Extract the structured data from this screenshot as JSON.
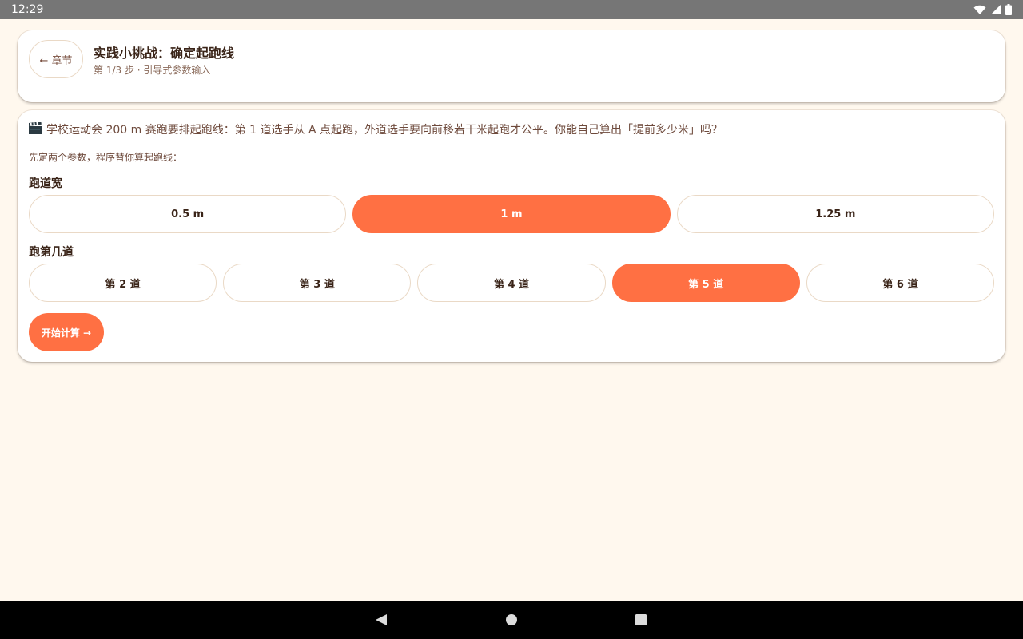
{
  "status_bar": {
    "time": "12:29",
    "icons": [
      "wifi-icon",
      "cell-signal-icon",
      "battery-icon"
    ]
  },
  "header": {
    "back_label": "← 章节",
    "title": "实践小挑战：确定起跑线",
    "subtitle": "第 1/3 步 · 引导式参数输入"
  },
  "challenge": {
    "icon": "clapperboard-icon",
    "intro": "学校运动会 200 m 赛跑要排起跑线：第 1 道选手从 A 点起跑，外道选手要向前移若干米起跑才公平。你能自己算出「提前多少米」吗？",
    "hint": "先定两个参数，程序替你算起跑线："
  },
  "track_width": {
    "label": "跑道宽",
    "options": [
      "0.5 m",
      "1 m",
      "1.25 m"
    ],
    "selected": "1 m"
  },
  "lane": {
    "label": "跑第几道",
    "options": [
      "第 2 道",
      "第 3 道",
      "第 4 道",
      "第 5 道",
      "第 6 道"
    ],
    "selected": "第 5 道"
  },
  "start_label": "开始计算 →",
  "colors": {
    "accent": "#ff7043",
    "background": "#fff8ee",
    "card": "#ffffff",
    "status_bar": "#767676",
    "nav_bar": "#000000"
  },
  "nav_bar": {
    "icons": [
      "back-triangle-icon",
      "home-circle-icon",
      "recents-square-icon"
    ]
  }
}
